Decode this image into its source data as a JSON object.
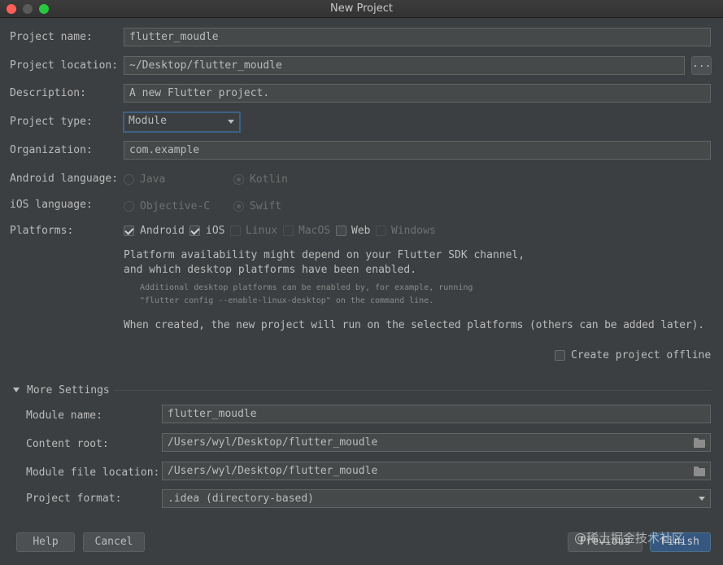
{
  "window": {
    "title": "New Project"
  },
  "form": {
    "project_name_label": "Project name:",
    "project_name_value": "flutter_moudle",
    "project_location_label": "Project location:",
    "project_location_value": "~/Desktop/flutter_moudle",
    "browse_label": "...",
    "description_label": "Description:",
    "description_value": "A new Flutter project.",
    "project_type_label": "Project type:",
    "project_type_value": "Module",
    "organization_label": "Organization:",
    "organization_value": "com.example",
    "android_language_label": "Android language:",
    "android_options": {
      "java": "Java",
      "kotlin": "Kotlin",
      "selected": "Kotlin"
    },
    "ios_language_label": "iOS language:",
    "ios_options": {
      "objc": "Objective-C",
      "swift": "Swift",
      "selected": "Swift"
    },
    "platforms_label": "Platforms:",
    "platforms": [
      {
        "label": "Android",
        "checked": true,
        "enabled": true
      },
      {
        "label": "iOS",
        "checked": true,
        "enabled": true
      },
      {
        "label": "Linux",
        "checked": false,
        "enabled": false
      },
      {
        "label": "MacOS",
        "checked": false,
        "enabled": false
      },
      {
        "label": "Web",
        "checked": false,
        "enabled": true
      },
      {
        "label": "Windows",
        "checked": false,
        "enabled": false
      }
    ],
    "platform_note_1": "Platform availability might depend on your Flutter SDK channel,",
    "platform_note_2": "and which desktop platforms have been enabled.",
    "platform_hint_1": "Additional desktop platforms can be enabled by, for example, running",
    "platform_hint_2": "\"flutter config --enable-linux-desktop\" on the command line.",
    "created_note": "When created, the new project will run on the selected platforms (others can be added later).",
    "offline_label": "Create project offline",
    "offline_checked": false
  },
  "more_settings": {
    "header": "More Settings",
    "module_name_label": "Module name:",
    "module_name_value": "flutter_moudle",
    "content_root_label": "Content root:",
    "content_root_value": "/Users/wyl/Desktop/flutter_moudle",
    "module_file_label": "Module file location:",
    "module_file_value": "/Users/wyl/Desktop/flutter_moudle",
    "project_format_label": "Project format:",
    "project_format_value": ".idea (directory-based)"
  },
  "buttons": {
    "help": "Help",
    "cancel": "Cancel",
    "previous": "Previous",
    "finish": "Finish"
  },
  "watermark": "@稀土掘金技术社区",
  "icons": [
    "close-light",
    "minimize-light",
    "maximize-light",
    "chevron-down-icon",
    "folder-icon",
    "checkbox",
    "radio"
  ]
}
